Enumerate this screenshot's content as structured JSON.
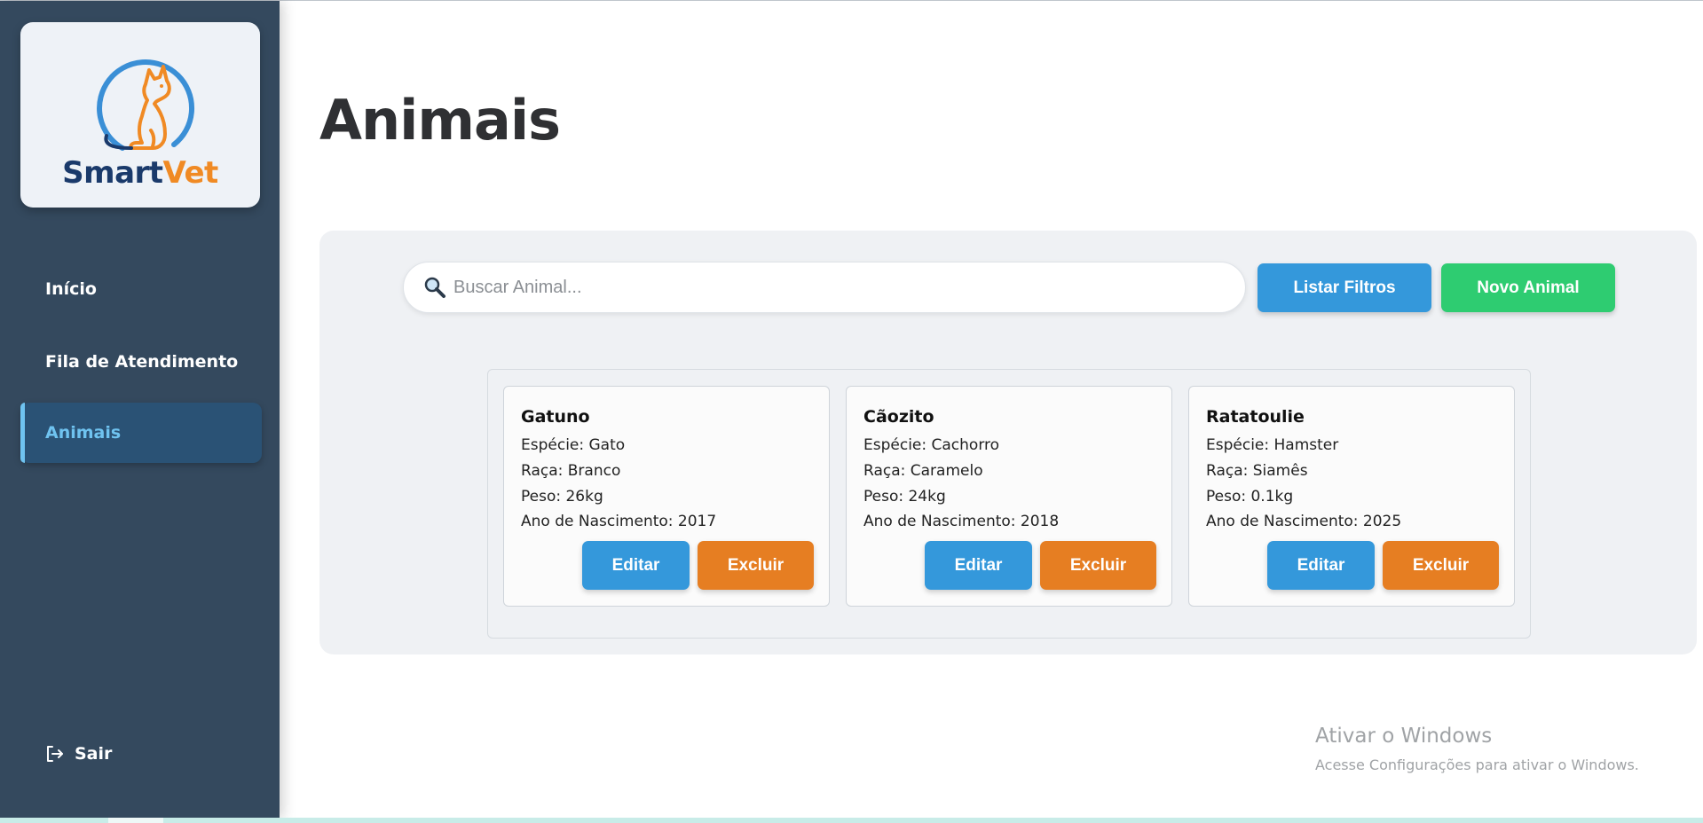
{
  "brand": {
    "name_part1": "Smart",
    "name_part2": "Vet",
    "colors": {
      "navy": "#1a3a6b",
      "orange": "#f08a24",
      "ring": "#3a8fd6"
    }
  },
  "sidebar": {
    "items": [
      {
        "label": "Início",
        "active": false
      },
      {
        "label": "Fila de Atendimento",
        "active": false
      },
      {
        "label": "Animais",
        "active": true
      }
    ],
    "logout_label": "Sair",
    "logout_icon": "logout-icon"
  },
  "main": {
    "title": "Animais",
    "search": {
      "placeholder": "Buscar Animal...",
      "value": "",
      "icon": "search-icon"
    },
    "filter_button": "Listar Filtros",
    "new_button": "Novo Animal",
    "cards": [
      {
        "name": "Gatuno",
        "species": "Espécie: Gato",
        "breed": "Raça: Branco",
        "weight": "Peso: 26kg",
        "birth": "Ano de Nascimento: 2017",
        "edit": "Editar",
        "delete": "Excluir"
      },
      {
        "name": "Cãozito",
        "species": "Espécie: Cachorro",
        "breed": "Raça: Caramelo",
        "weight": "Peso: 24kg",
        "birth": "Ano de Nascimento: 2018",
        "edit": "Editar",
        "delete": "Excluir"
      },
      {
        "name": "Ratatoulie",
        "species": "Espécie: Hamster",
        "breed": "Raça: Siamês",
        "weight": "Peso: 0.1kg",
        "birth": "Ano de Nascimento: 2025",
        "edit": "Editar",
        "delete": "Excluir"
      }
    ]
  },
  "watermark": {
    "line1": "Ativar o Windows",
    "line2": "Acesse Configurações para ativar o Windows."
  },
  "colors": {
    "sidebar_bg": "#34495e",
    "active_bg": "#2a5275",
    "active_text": "#6fc3f0",
    "blue": "#3498db",
    "green": "#2ecc71",
    "orange": "#e67e22"
  }
}
